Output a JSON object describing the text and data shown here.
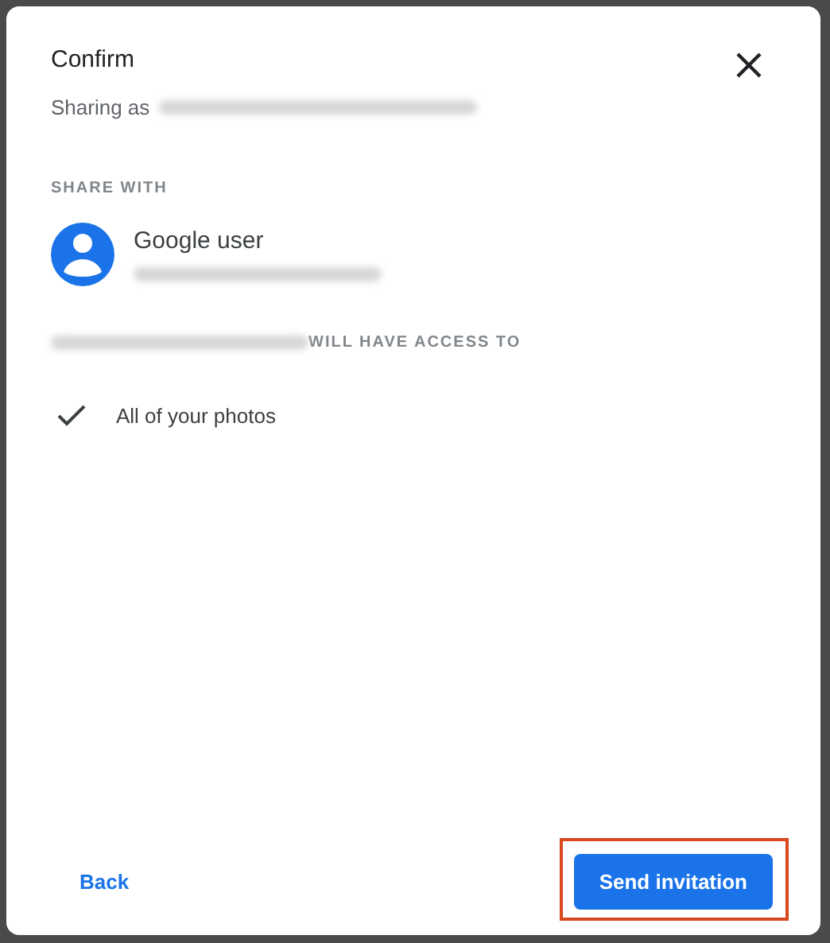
{
  "dialog": {
    "title": "Confirm",
    "sharing_as_label": "Sharing as",
    "section_label": "SHARE WITH",
    "recipient": {
      "name": "Google user"
    },
    "access_label": "WILL HAVE ACCESS TO",
    "access_items": [
      {
        "label": "All of your photos",
        "checked": true
      }
    ],
    "back_button": "Back",
    "send_button": {
      "label": "Send invitation",
      "highlighted": true
    }
  }
}
